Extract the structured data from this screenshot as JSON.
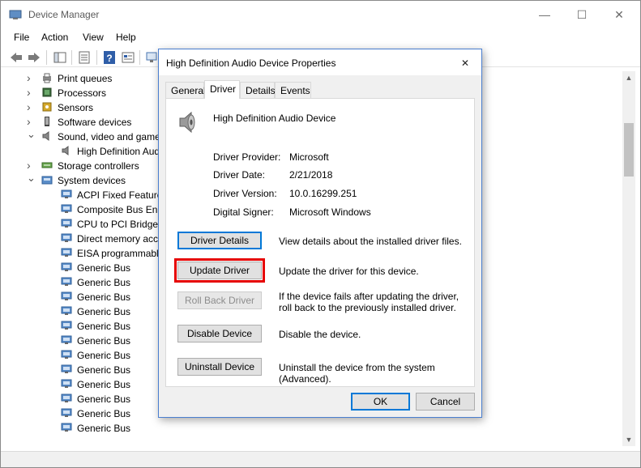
{
  "window": {
    "title": "Device Manager",
    "controls": {
      "minimize": "—",
      "maximize": "☐",
      "close": "✕"
    }
  },
  "menu": [
    "File",
    "Action",
    "View",
    "Help"
  ],
  "toolbar": {
    "icons": [
      "back-arrow-icon",
      "forward-arrow-icon",
      "show-hide-console-tree-icon",
      "properties-icon",
      "help-icon",
      "console-view-icon",
      "scan-hardware-icon"
    ]
  },
  "tree": {
    "items": [
      {
        "label": "Print queues",
        "expanded": false,
        "level": 1,
        "icon": "printer-icon"
      },
      {
        "label": "Processors",
        "expanded": false,
        "level": 1,
        "icon": "chip-icon"
      },
      {
        "label": "Sensors",
        "expanded": false,
        "level": 1,
        "icon": "sensor-icon"
      },
      {
        "label": "Software devices",
        "expanded": false,
        "level": 1,
        "icon": "software-device-icon"
      },
      {
        "label": "Sound, video and game",
        "expanded": true,
        "level": 1,
        "icon": "speaker-icon"
      },
      {
        "label": "High Definition Aud",
        "level": 2,
        "icon": "speaker-icon"
      },
      {
        "label": "Storage controllers",
        "expanded": false,
        "level": 1,
        "icon": "storage-icon"
      },
      {
        "label": "System devices",
        "expanded": true,
        "level": 1,
        "icon": "system-folder-icon"
      },
      {
        "label": "ACPI Fixed Feature B",
        "level": 2,
        "icon": "system-device-icon"
      },
      {
        "label": "Composite Bus Enun",
        "level": 2,
        "icon": "system-device-icon"
      },
      {
        "label": "CPU to PCI Bridge",
        "level": 2,
        "icon": "system-device-icon"
      },
      {
        "label": "Direct memory acce",
        "level": 2,
        "icon": "system-device-icon"
      },
      {
        "label": "EISA programmable",
        "level": 2,
        "icon": "system-device-icon"
      },
      {
        "label": "Generic Bus",
        "level": 2,
        "icon": "system-device-icon"
      },
      {
        "label": "Generic Bus",
        "level": 2,
        "icon": "system-device-icon"
      },
      {
        "label": "Generic Bus",
        "level": 2,
        "icon": "system-device-icon"
      },
      {
        "label": "Generic Bus",
        "level": 2,
        "icon": "system-device-icon"
      },
      {
        "label": "Generic Bus",
        "level": 2,
        "icon": "system-device-icon"
      },
      {
        "label": "Generic Bus",
        "level": 2,
        "icon": "system-device-icon"
      },
      {
        "label": "Generic Bus",
        "level": 2,
        "icon": "system-device-icon"
      },
      {
        "label": "Generic Bus",
        "level": 2,
        "icon": "system-device-icon"
      },
      {
        "label": "Generic Bus",
        "level": 2,
        "icon": "system-device-icon"
      },
      {
        "label": "Generic Bus",
        "level": 2,
        "icon": "system-device-icon"
      },
      {
        "label": "Generic Bus",
        "level": 2,
        "icon": "system-device-icon"
      },
      {
        "label": "Generic Bus",
        "level": 2,
        "icon": "system-device-icon"
      }
    ]
  },
  "dialog": {
    "title": "High Definition Audio Device Properties",
    "close": "✕",
    "tabs": [
      "General",
      "Driver",
      "Details",
      "Events"
    ],
    "active_tab": "Driver",
    "device_name": "High Definition Audio Device",
    "properties": [
      {
        "label": "Driver Provider:",
        "value": "Microsoft"
      },
      {
        "label": "Driver Date:",
        "value": "2/21/2018"
      },
      {
        "label": "Driver Version:",
        "value": "10.0.16299.251"
      },
      {
        "label": "Digital Signer:",
        "value": "Microsoft Windows"
      }
    ],
    "actions": [
      {
        "button": "Driver Details",
        "description": "View details about the installed driver files.",
        "state": "focused"
      },
      {
        "button": "Update Driver",
        "description": "Update the driver for this device.",
        "state": "highlighted"
      },
      {
        "button": "Roll Back Driver",
        "description": "If the device fails after updating the driver, roll back to the previously installed driver.",
        "state": "disabled"
      },
      {
        "button": "Disable Device",
        "description": "Disable the device.",
        "state": "normal"
      },
      {
        "button": "Uninstall Device",
        "description": "Uninstall the device from the system (Advanced).",
        "state": "normal"
      }
    ],
    "ok": "OK",
    "cancel": "Cancel"
  },
  "colors": {
    "highlight_box": "#e60000",
    "accent": "#0078d7",
    "dialog_bg": "#f0f0f0"
  }
}
